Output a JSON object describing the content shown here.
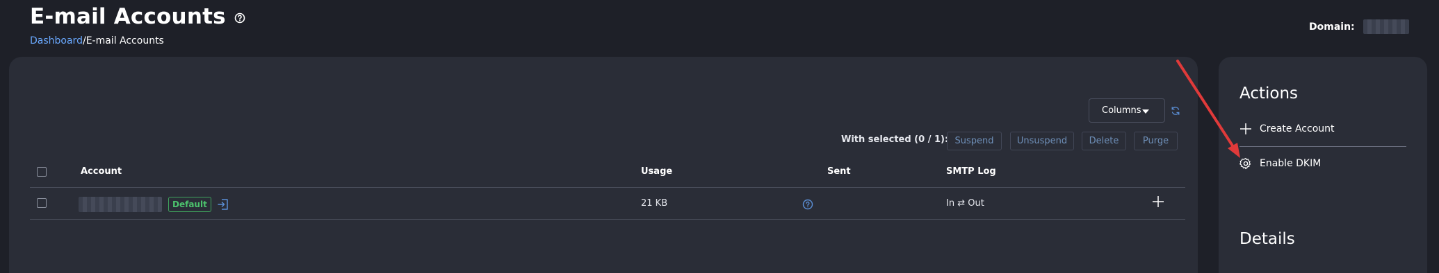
{
  "header": {
    "title": "E-mail Accounts",
    "help_icon": "help-circle-icon",
    "domain_label": "Domain:"
  },
  "breadcrumb": {
    "home": "Dashboard",
    "separator": "/",
    "current": "E-mail Accounts"
  },
  "toolbar": {
    "columns_label": "Columns",
    "refresh_icon": "refresh-icon"
  },
  "bulk": {
    "with_selected": "With selected (0 / 1):",
    "suspend": "Suspend",
    "unsuspend": "Unsuspend",
    "delete": "Delete",
    "purge": "Purge"
  },
  "table": {
    "columns": [
      "Account",
      "Usage",
      "Sent",
      "SMTP Log"
    ],
    "rows": [
      {
        "badge": "Default",
        "usage": "21 KB",
        "smtp_log": "In ⇄ Out"
      }
    ]
  },
  "sidebar": {
    "actions_title": "Actions",
    "create_account": "Create Account",
    "enable_dkim": "Enable DKIM",
    "details_title": "Details"
  },
  "colors": {
    "background": "#1e2028",
    "card": "#2a2d37",
    "link": "#6aa9ff",
    "badge_green": "#4cc36d",
    "annotation_red": "#e03a3a"
  }
}
